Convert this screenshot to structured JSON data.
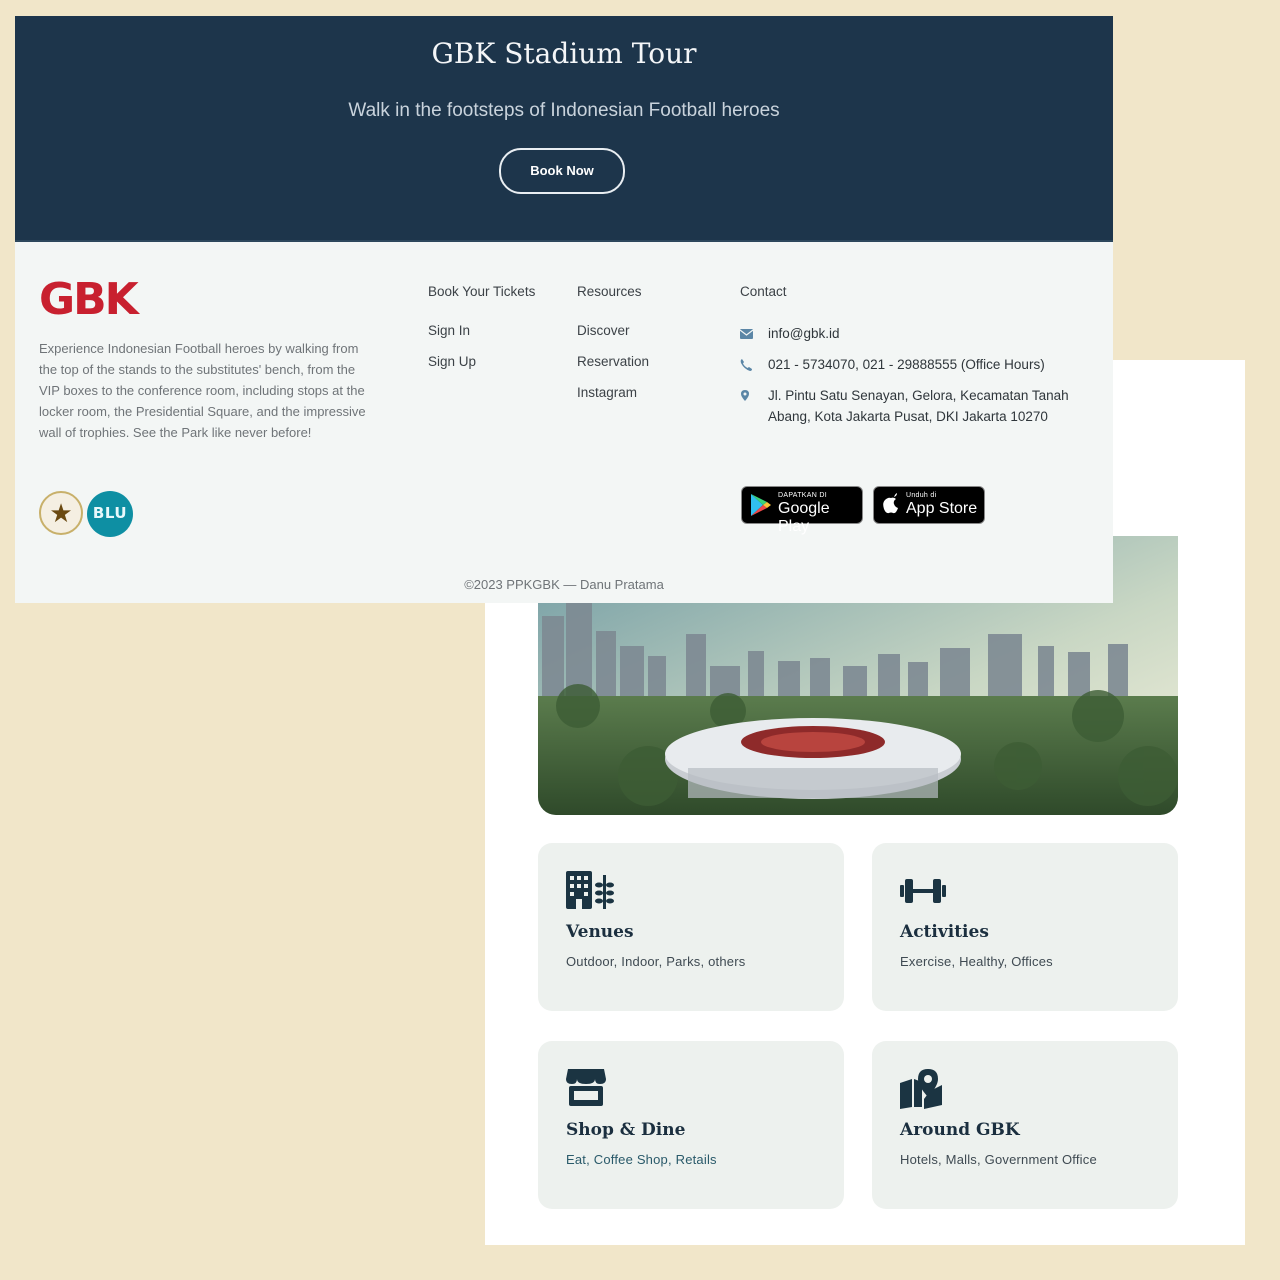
{
  "banner": {
    "title": "GBK Stadium Tour",
    "subtitle": "Walk in the footsteps of Indonesian Football heroes",
    "book_label": "Book Now",
    "background": "#1d354b"
  },
  "footer": {
    "logo_text": "GBK",
    "description": "Experience Indonesian Football heroes by walking from the top of the stands to the substitutes' bench, from the VIP boxes to the conference room, including stops at the locker room, the Presidential Square, and the impressive wall of trophies. See the Park like never before!",
    "badges": {
      "blu_text": "BLU"
    },
    "columns": {
      "tickets": {
        "heading": "Book Your Tickets",
        "links": [
          "Sign In",
          "Sign Up"
        ]
      },
      "resources": {
        "heading": "Resources",
        "links": [
          "Discover",
          "Reservation",
          "Instagram"
        ]
      },
      "contact": {
        "heading": "Contact",
        "email": "info@gbk.id",
        "phone": "021 - 5734070, 021 - 29888555 (Office Hours)",
        "address": "Jl. Pintu Satu Senayan, Gelora, Kecamatan Tanah Abang, Kota Jakarta Pusat, DKI Jakarta 10270"
      }
    },
    "stores": {
      "google_small": "DAPATKAN DI",
      "google_big": "Google Play",
      "apple_small": "Unduh di",
      "apple_big": "App Store"
    },
    "copyright": "©2023 PPKGBK — Danu Pratama"
  },
  "categories": [
    {
      "title": "Venues",
      "subtitle": "Outdoor, Indoor, Parks, others",
      "icon": "building-icon"
    },
    {
      "title": "Activities",
      "subtitle": "Exercise, Healthy, Offices",
      "icon": "dumbbell-icon"
    },
    {
      "title": "Shop & Dine",
      "subtitle": "Eat, Coffee Shop, Retails",
      "icon": "store-icon"
    },
    {
      "title": "Around GBK",
      "subtitle": "Hotels, Malls, Government Office",
      "icon": "map-pin-icon"
    }
  ],
  "colors": {
    "accent_red": "#c8202f",
    "navy": "#1d354b",
    "card_bg": "#edf1ee",
    "page_bg": "#f1e6c9"
  }
}
